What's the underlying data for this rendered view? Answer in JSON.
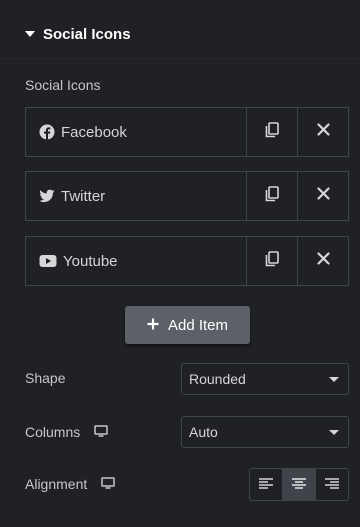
{
  "section": {
    "title": "Social Icons"
  },
  "repeater": {
    "label": "Social Icons",
    "items": [
      {
        "label": "Facebook",
        "icon": "facebook-icon"
      },
      {
        "label": "Twitter",
        "icon": "twitter-icon"
      },
      {
        "label": "Youtube",
        "icon": "youtube-icon"
      }
    ],
    "add_label": "Add Item"
  },
  "shape": {
    "label": "Shape",
    "value": "Rounded"
  },
  "columns": {
    "label": "Columns",
    "value": "Auto",
    "device_icon": "desktop-icon"
  },
  "alignment": {
    "label": "Alignment",
    "device_icon": "desktop-icon",
    "options": [
      "align-left-icon",
      "align-center-icon",
      "align-right-icon"
    ],
    "selected": "center"
  },
  "colors": {
    "background": "#1f2124",
    "border": "#3f444b",
    "button": "#5c6168",
    "text": "#c6c7c9",
    "active": "#404349"
  }
}
